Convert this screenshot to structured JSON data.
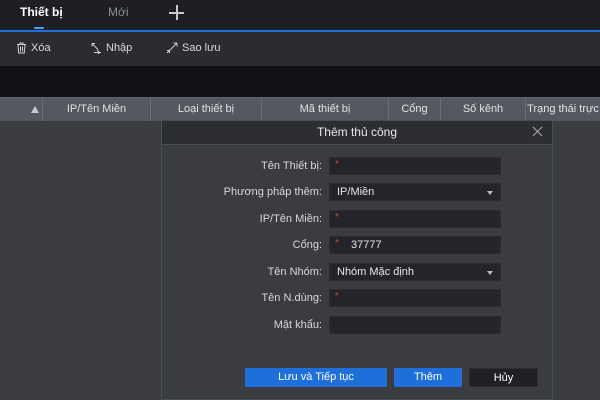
{
  "tabs": {
    "active": "Thiết bị",
    "new": "Mới"
  },
  "toolbar": {
    "delete_label": "Xóa",
    "import_label": "Nhập",
    "backup_label": "Sao lưu"
  },
  "table": {
    "columns": [
      "IP/Tên Miền",
      "Loại thiết bị",
      "Mã thiết bị",
      "Cổng",
      "Số kênh",
      "Trạng thái trực"
    ]
  },
  "dialog": {
    "title": "Thêm thủ công",
    "required_mark": "*",
    "fields": {
      "device_name": {
        "label": "Tên Thiết bị:",
        "value": ""
      },
      "add_method": {
        "label": "Phương pháp thêm:",
        "value": "IP/Miền"
      },
      "ip_domain": {
        "label": "IP/Tên Miền:",
        "value": ""
      },
      "port": {
        "label": "Cổng:",
        "value": "37777"
      },
      "group_name": {
        "label": "Tên Nhóm:",
        "value": "Nhóm Mặc định"
      },
      "username": {
        "label": "Tên N.dùng:",
        "value": ""
      },
      "password": {
        "label": "Mật khẩu:",
        "value": ""
      }
    },
    "buttons": {
      "save_continue": "Lưu và Tiếp tục",
      "add": "Thêm",
      "cancel": "Hủy"
    }
  },
  "colors": {
    "accent": "#1f6fdb",
    "required": "#e23b3b",
    "tabbar_bg": "#1d1f23"
  }
}
